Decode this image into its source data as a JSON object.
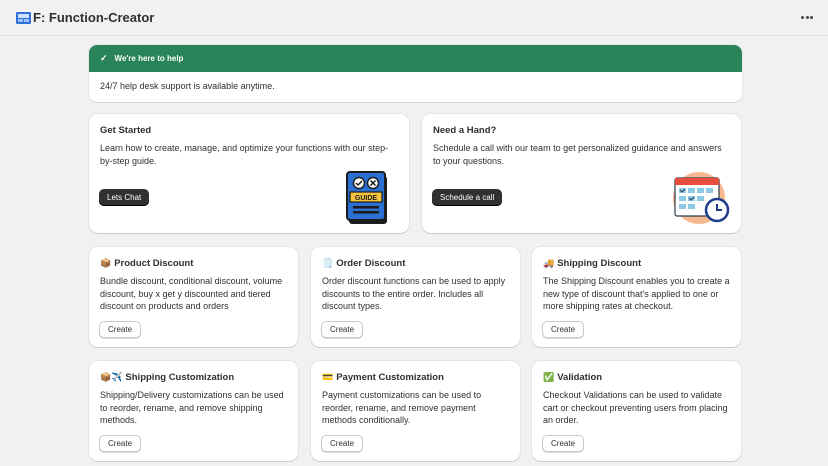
{
  "app": {
    "title": "F: Function-Creator"
  },
  "banner": {
    "title": "We're here to help",
    "text": "24/7 help desk support is available anytime.",
    "color": "#29845a"
  },
  "get_started": {
    "title": "Get Started",
    "text": "Learn how to create, manage, and optimize your functions with our step-by-step guide.",
    "button": "Lets Chat",
    "illustration_text": "GUIDE"
  },
  "need_hand": {
    "title": "Need a Hand?",
    "text": "Schedule a call with our team to get personalized guidance and answers to your questions.",
    "button": "Schedule a call"
  },
  "features": [
    {
      "icon": "📦",
      "title": "Product Discount",
      "text": "Bundle discount, conditional discount, volume discount, buy x get y discounted and tiered discount on products and orders",
      "button": "Create"
    },
    {
      "icon": "🗒️",
      "title": "Order Discount",
      "text": "Order discount functions can be used to apply discounts to the entire order. Includes all discount types.",
      "button": "Create"
    },
    {
      "icon": "🚚",
      "title": "Shipping Discount",
      "text": "The Shipping Discount enables you to create a new type of discount that's applied to one or more shipping rates at checkout.",
      "button": "Create"
    },
    {
      "icon": "📦✈️",
      "title": "Shipping Customization",
      "text": "Shipping/Delivery customizations can be used to reorder, rename, and remove shipping methods.",
      "button": "Create"
    },
    {
      "icon": "💳",
      "title": "Payment Customization",
      "text": "Payment customizations can be used to reorder, rename, and remove payment methods conditionally.",
      "button": "Create"
    },
    {
      "icon": "✅",
      "title": "Validation",
      "text": "Checkout Validations can be used to validate cart or checkout preventing users from placing an order.",
      "button": "Create"
    }
  ]
}
